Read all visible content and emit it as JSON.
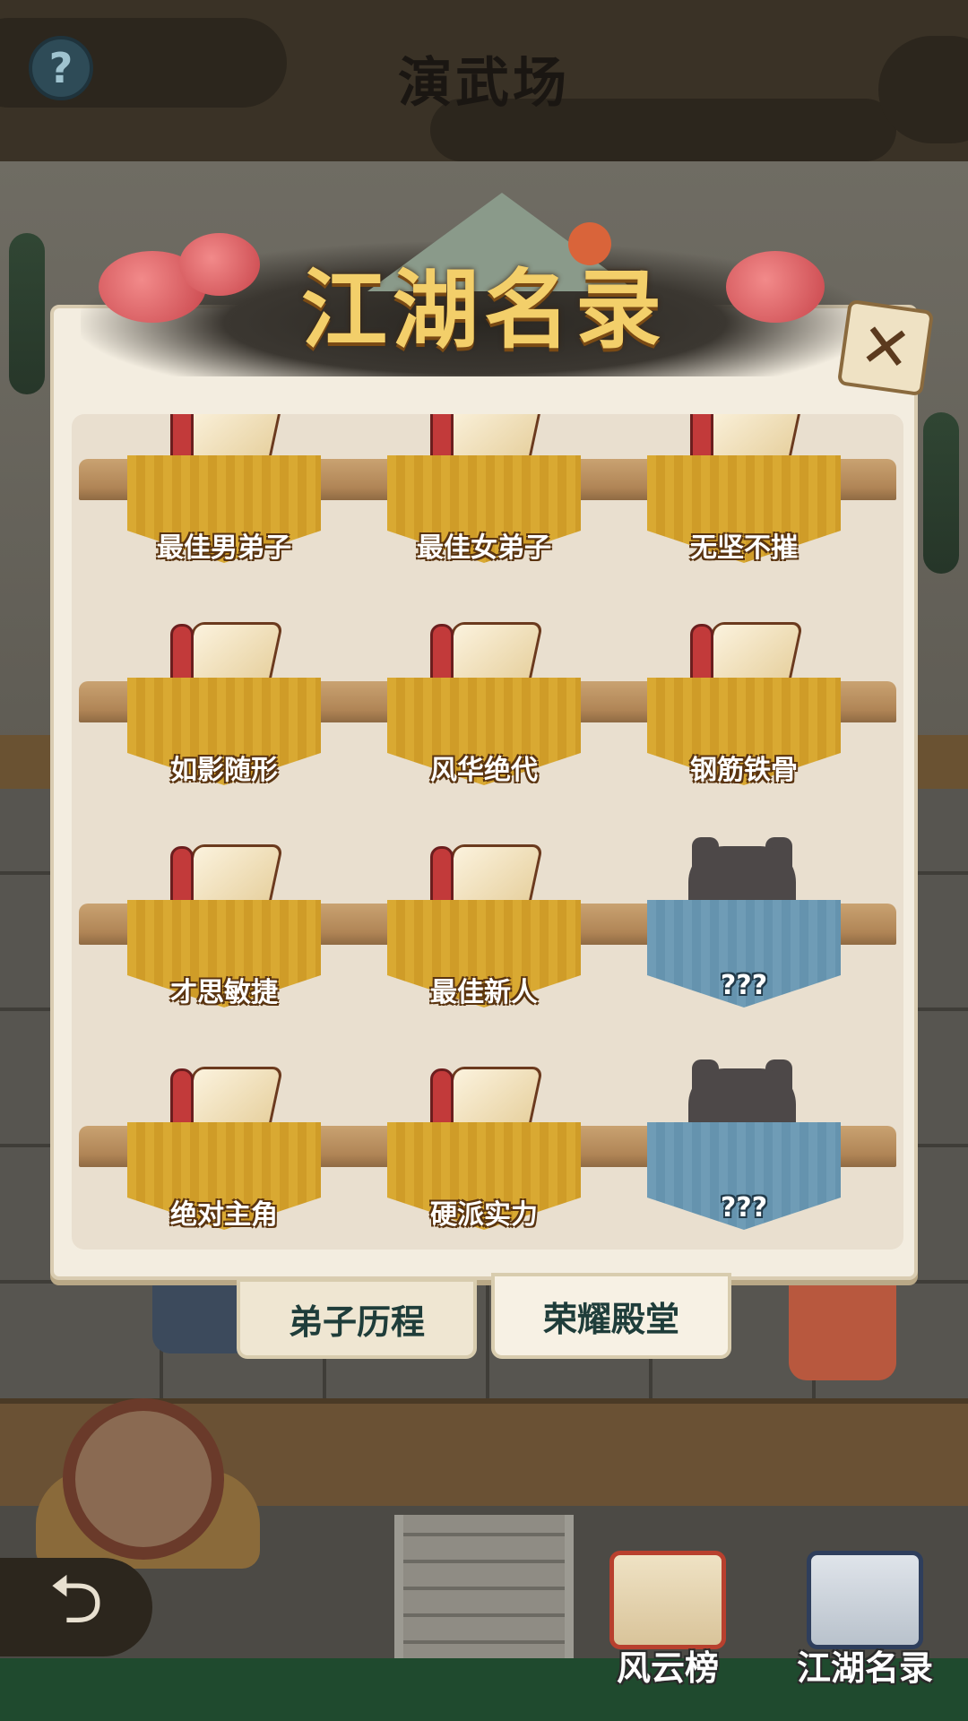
{
  "header": {
    "help_icon": "question-mark-icon",
    "help_glyph": "?",
    "scene_title": "演武场"
  },
  "modal": {
    "title": "江湖名录",
    "close_icon": "close-x-icon",
    "close_glyph": "✕",
    "awards": [
      {
        "label": "最佳男弟子",
        "unlocked": true
      },
      {
        "label": "最佳女弟子",
        "unlocked": true
      },
      {
        "label": "无坚不摧",
        "unlocked": true
      },
      {
        "label": "如影随形",
        "unlocked": true
      },
      {
        "label": "风华绝代",
        "unlocked": true
      },
      {
        "label": "钢筋铁骨",
        "unlocked": true
      },
      {
        "label": "才思敏捷",
        "unlocked": true
      },
      {
        "label": "最佳新人",
        "unlocked": true
      },
      {
        "label": "???",
        "unlocked": false
      },
      {
        "label": "绝对主角",
        "unlocked": true
      },
      {
        "label": "硬派实力",
        "unlocked": true
      },
      {
        "label": "???",
        "unlocked": false
      }
    ]
  },
  "tabs": [
    {
      "label": "弟子历程",
      "active": false
    },
    {
      "label": "荣耀殿堂",
      "active": true
    }
  ],
  "bottom_nav": {
    "back_icon": "back-arrow-icon",
    "back_glyph": "⮌",
    "items": [
      {
        "label": "风云榜",
        "icon": "ranking-scroll-icon"
      },
      {
        "label": "江湖名录",
        "icon": "book-icon"
      }
    ]
  },
  "colors": {
    "gold_plaque": "#d9a932",
    "locked_plaque": "#6f9cb6",
    "modal_bg": "#f3ede0",
    "title_gold": "#f3cf6a"
  }
}
